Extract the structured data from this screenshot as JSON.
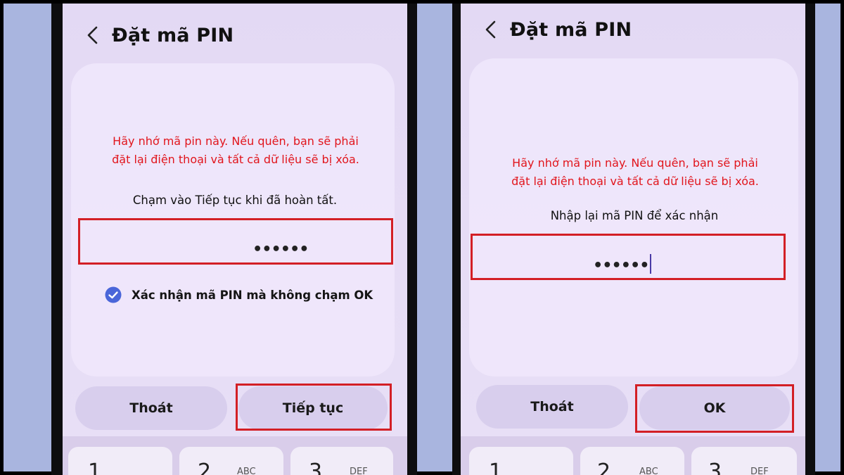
{
  "left_screen": {
    "title": "Đặt mã PIN",
    "warning_line1": "Hãy nhớ mã pin này. Nếu quên, bạn sẽ phải",
    "warning_line2": "đặt lại điện thoại và tất cả dữ liệu sẽ bị xóa.",
    "instruction": "Chạm vào Tiếp tục khi đã hoàn tất.",
    "pin_value": "••••••",
    "checkbox_label": "Xác nhận mã PIN mà không chạm OK",
    "checkbox_checked": true,
    "cancel_label": "Thoát",
    "continue_label": "Tiếp tục",
    "keys": [
      {
        "num": "1",
        "sub": ""
      },
      {
        "num": "2",
        "sub": "ABC"
      },
      {
        "num": "3",
        "sub": "DEF"
      }
    ]
  },
  "right_screen": {
    "title": "Đặt mã PIN",
    "warning_line1": "Hãy nhớ mã pin này. Nếu quên, bạn sẽ phải",
    "warning_line2": "đặt lại điện thoại và tất cả dữ liệu sẽ bị xóa.",
    "instruction": "Nhập lại mã PIN để xác nhận",
    "pin_value": "••••••",
    "cancel_label": "Thoát",
    "ok_label": "OK",
    "keys": [
      {
        "num": "1",
        "sub": ""
      },
      {
        "num": "2",
        "sub": "ABC"
      },
      {
        "num": "3",
        "sub": "DEF"
      }
    ]
  },
  "icons": {
    "back": "chevron-left-icon",
    "check": "check-circle-icon"
  },
  "colors": {
    "warning": "#e1151c",
    "highlight_box": "#d31f25",
    "checkbox": "#4a66d9",
    "background": "#a9b5df"
  }
}
